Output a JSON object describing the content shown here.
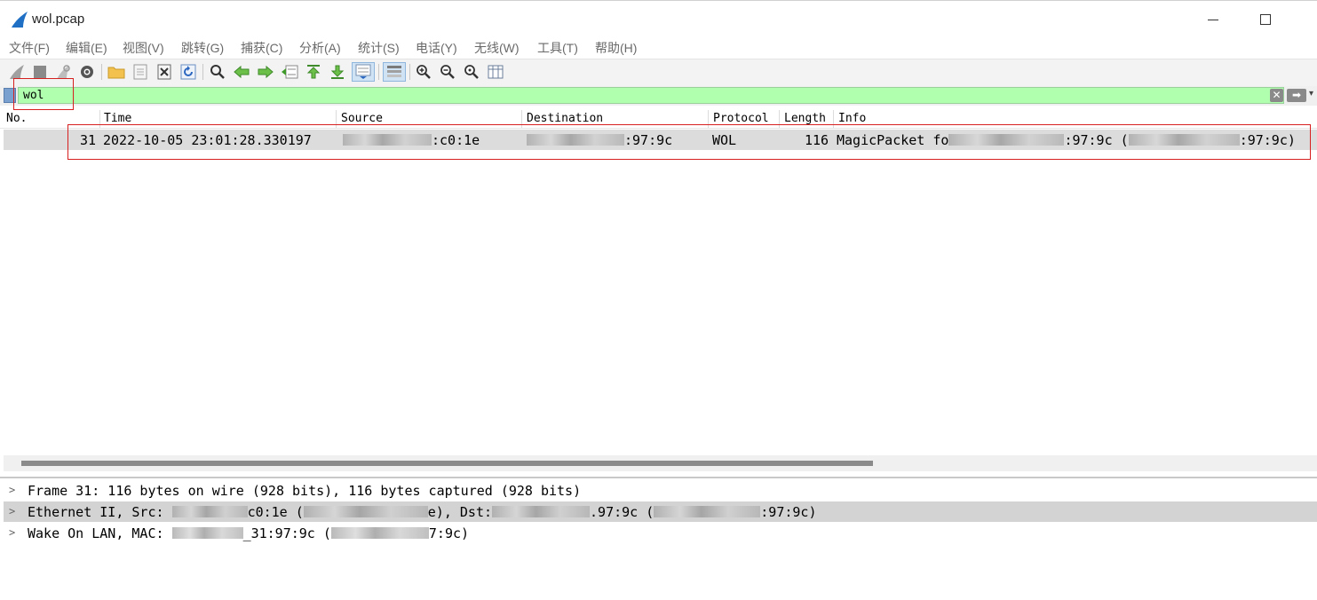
{
  "window": {
    "title": "wol.pcap"
  },
  "menu": [
    "文件(F)",
    "编辑(E)",
    "视图(V)",
    "跳转(G)",
    "捕获(C)",
    "分析(A)",
    "统计(S)",
    "电话(Y)",
    "无线(W)",
    "工具(T)",
    "帮助(H)"
  ],
  "filter": {
    "value": "wol"
  },
  "columns": {
    "no": "No.",
    "time": "Time",
    "source": "Source",
    "destination": "Destination",
    "protocol": "Protocol",
    "length": "Length",
    "info": "Info"
  },
  "packet": {
    "no": "31",
    "time": "2022-10-05 23:01:28.330197",
    "source_visible": ":c0:1e",
    "destination_visible": ":97:9c",
    "protocol": "WOL",
    "length": "116",
    "info_prefix": "MagicPacket fo",
    "info_mid": ":97:9c (",
    "info_end": ":97:9c)"
  },
  "details": {
    "frame": "Frame 31: 116 bytes on wire (928 bits), 116 bytes captured (928 bits)",
    "ethernet_a": "Ethernet II, Src: ",
    "ethernet_b": "c0:1e (",
    "ethernet_c": "e), Dst:",
    "ethernet_d": ".97:9c (",
    "ethernet_e": ":97:9c)",
    "wol_a": "Wake On LAN, MAC: ",
    "wol_b": "_31:97:9c (",
    "wol_c": "7:9c)"
  },
  "colors": {
    "filter_bg": "#afffaf",
    "selected_row": "#dcdcdc",
    "annotation": "#d62020"
  }
}
